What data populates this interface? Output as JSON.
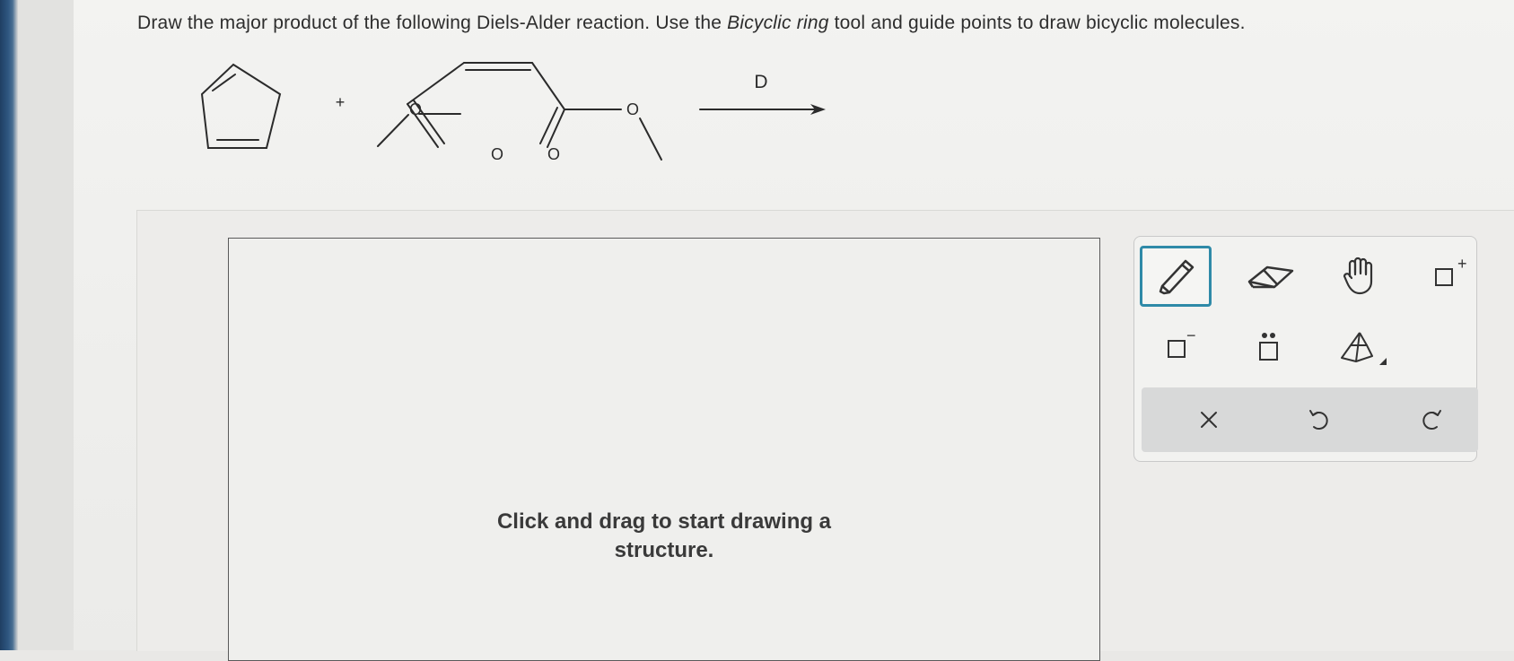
{
  "question": {
    "text_before": "Draw the major product of the following Diels-Alder reaction. Use the ",
    "text_emphasis": "Bicyclic ring",
    "text_after": " tool and guide points to draw bicyclic molecules."
  },
  "reaction": {
    "plus": "+",
    "oxygen_labels": [
      "O",
      "O",
      "O",
      "O"
    ],
    "condition": "D"
  },
  "canvas": {
    "hint_line1": "Click and drag to start drawing a",
    "hint_line2": "structure."
  },
  "toolbar": {
    "tools": [
      {
        "name": "pencil-tool",
        "icon": "pencil-icon",
        "active": true
      },
      {
        "name": "eraser-tool",
        "icon": "eraser-icon",
        "active": false
      },
      {
        "name": "hand-tool",
        "icon": "hand-icon",
        "active": false
      },
      {
        "name": "positive-charge-tool",
        "icon": "positive-charge-icon",
        "active": false
      },
      {
        "name": "negative-charge-tool",
        "icon": "negative-charge-icon",
        "active": false
      },
      {
        "name": "lone-pair-tool",
        "icon": "lone-pair-icon",
        "active": false
      },
      {
        "name": "bicyclic-ring-tool",
        "icon": "bicyclic-ring-icon",
        "active": false
      }
    ],
    "charge_plus": "+",
    "charge_minus": "−",
    "actions": [
      {
        "name": "clear-button",
        "icon": "close-icon",
        "glyph": "×"
      },
      {
        "name": "undo-button",
        "icon": "undo-icon"
      },
      {
        "name": "redo-button",
        "icon": "redo-icon"
      }
    ]
  },
  "colors": {
    "accent": "#2f8aa8",
    "text": "#2d2d2d",
    "actions_bg": "#d8d9d9"
  }
}
